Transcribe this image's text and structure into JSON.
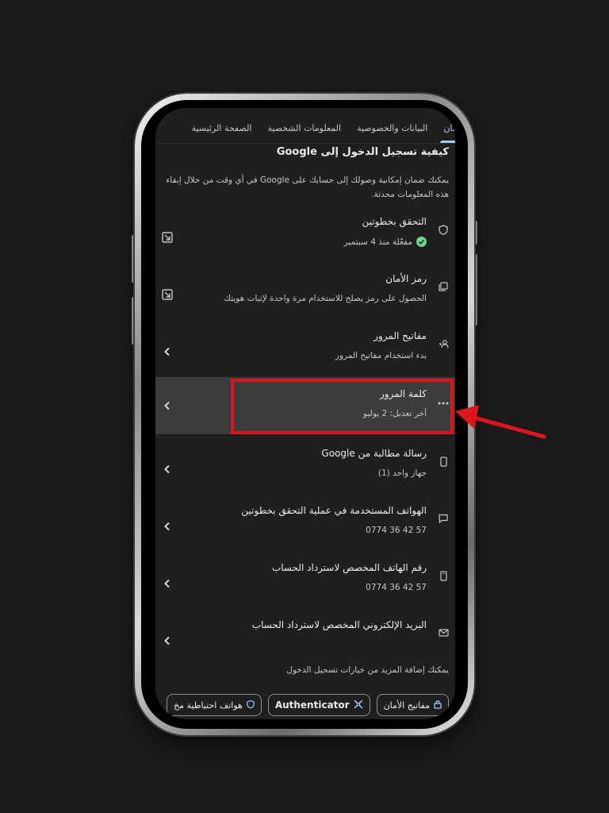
{
  "tabs": [
    {
      "label": "الأمان",
      "active": true
    },
    {
      "label": "البيانات والخصوصية",
      "active": false
    },
    {
      "label": "المعلومات الشخصية",
      "active": false
    },
    {
      "label": "الصفحة الرئيسية",
      "active": false
    }
  ],
  "section": {
    "title": "كيفية تسجيل الدخول إلى Google",
    "description": "يمكنك ضمان إمكانية وصولك إلى حسابك على Google في أي وقت من خلال إبقاء هذه المعلومات محدثة."
  },
  "items": [
    {
      "title": "التحقق بخطوتين",
      "subtitle": "مفعّلة منذ 4 سبتمبر",
      "icon": "shield-icon",
      "trail": "external-link-icon",
      "status": "enabled"
    },
    {
      "title": "رمز الأمان",
      "subtitle": "الحصول على رمز يصلح للاستخدام مرة واحدة لإثبات هويتك",
      "icon": "copy-code-icon",
      "trail": "external-link-icon"
    },
    {
      "title": "مفاتيح المرور",
      "subtitle": "بدء استخدام مفاتيح المرور",
      "icon": "person-key-icon",
      "trail": "chevron-left-icon"
    },
    {
      "title": "كلمة المرور",
      "subtitle": "آخر تعديل: 2 يوليو",
      "icon": "password-dots-icon",
      "trail": "chevron-left-icon",
      "highlighted": true
    },
    {
      "title": "رسالة مطالبة من Google",
      "subtitle": "جهاز واحد (1)",
      "icon": "phone-icon",
      "trail": "chevron-left-icon"
    },
    {
      "title": "الهواتف المستخدمة في عملية التحقق بخطوتين",
      "subtitle": "0774 36 42 57",
      "icon": "message-icon",
      "trail": "chevron-left-icon"
    },
    {
      "title": "رقم الهاتف المخصص لاسترداد الحساب",
      "subtitle": "0774 36 42 57",
      "icon": "mobile-icon",
      "trail": "chevron-left-icon"
    },
    {
      "title": "البريد الإلكتروني المخصص لاسترداد الحساب",
      "subtitle": "",
      "icon": "mail-icon",
      "trail": "chevron-left-icon"
    }
  ],
  "more_options_text": "يمكنك إضافة المزيد من خيارات تسجيل الدخول",
  "chips": [
    {
      "label": "مفاتيح الأمان",
      "icon": "lock-icon"
    },
    {
      "label": "Authenticator",
      "icon": "authenticator-icon"
    },
    {
      "label": "هواتف احتياطية مخ",
      "icon": "shield-icon"
    }
  ],
  "colors": {
    "background": "#1b1b1b",
    "screen": "#1f1f1f",
    "highlight_row": "#3c3c3c",
    "accent": "#a8c7fa",
    "success": "#6dd58c",
    "annotation": "#e0141d"
  }
}
